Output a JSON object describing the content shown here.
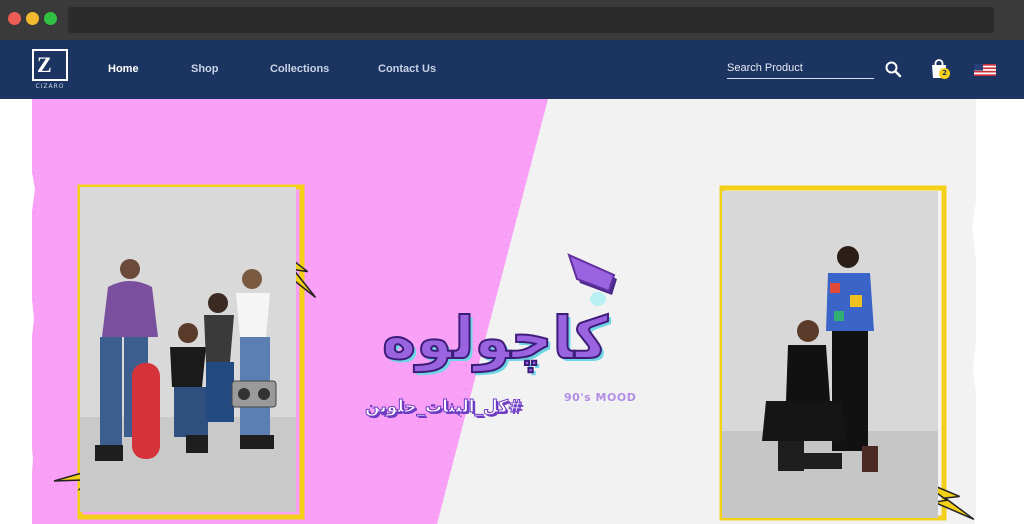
{
  "browser": {
    "url": ""
  },
  "nav": {
    "brand": "CIZARO",
    "links": [
      "Home",
      "Shop",
      "Collections",
      "Contact Us"
    ],
    "active": "Home",
    "search_placeholder": "Search Product",
    "cart_count": "2"
  },
  "hero": {
    "title": "كاچولوه",
    "hashtag": "#كل_البنات_حلوين",
    "mood": "90's MOOD"
  },
  "colors": {
    "nav_bg": "#1c3461",
    "pink": "#f9a1f6",
    "light_bg": "#f2f2f2",
    "accent_yellow": "#f5d019",
    "purple": "#8a55d8"
  },
  "icons": [
    "search-icon",
    "shopping-bag-icon",
    "us-flag-icon",
    "lightning-bolt-icon"
  ]
}
